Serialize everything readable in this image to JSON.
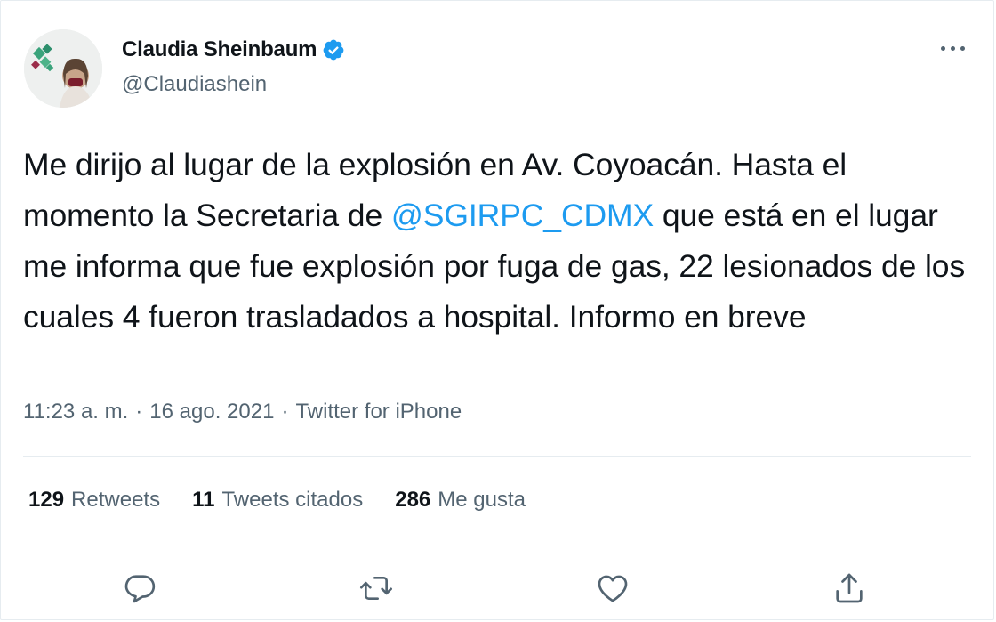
{
  "user": {
    "name": "Claudia Sheinbaum",
    "handle": "@Claudiashein"
  },
  "tweet": {
    "text_before_mention": "Me dirijo al lugar de la explosión en Av. Coyoacán. Hasta el momento la Secretaria de ",
    "mention": "@SGIRPC_CDMX",
    "text_after_mention": " que está en el lugar me informa que fue explosión por fuga de gas, 22 lesionados de los cuales 4 fueron trasladados a hospital. Informo en breve"
  },
  "meta": {
    "time": "11:23 a. m.",
    "dot1": "·",
    "date": "16 ago. 2021",
    "dot2": "·",
    "source": "Twitter for iPhone"
  },
  "stats": {
    "retweets_count": "129",
    "retweets_label": "Retweets",
    "quotes_count": "11",
    "quotes_label": "Tweets citados",
    "likes_count": "286",
    "likes_label": "Me gusta"
  },
  "icons": {
    "reply": "reply-icon",
    "retweet": "retweet-icon",
    "like": "like-icon",
    "share": "share-icon",
    "verified": "verified-badge-icon",
    "more": "more-options-icon"
  },
  "colors": {
    "link": "#1d9bf0",
    "secondary_text": "#536471",
    "primary_text": "#0f1419",
    "divider": "#e6ecf0"
  }
}
